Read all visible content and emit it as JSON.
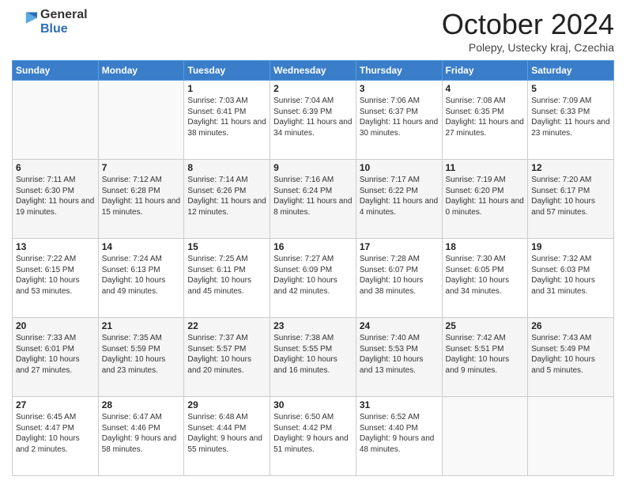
{
  "header": {
    "logo_general": "General",
    "logo_blue": "Blue",
    "month_title": "October 2024",
    "location": "Polepy, Ustecky kraj, Czechia"
  },
  "weekdays": [
    "Sunday",
    "Monday",
    "Tuesday",
    "Wednesday",
    "Thursday",
    "Friday",
    "Saturday"
  ],
  "weeks": [
    [
      {
        "day": "",
        "info": ""
      },
      {
        "day": "",
        "info": ""
      },
      {
        "day": "1",
        "info": "Sunrise: 7:03 AM\nSunset: 6:41 PM\nDaylight: 11 hours and 38 minutes."
      },
      {
        "day": "2",
        "info": "Sunrise: 7:04 AM\nSunset: 6:39 PM\nDaylight: 11 hours and 34 minutes."
      },
      {
        "day": "3",
        "info": "Sunrise: 7:06 AM\nSunset: 6:37 PM\nDaylight: 11 hours and 30 minutes."
      },
      {
        "day": "4",
        "info": "Sunrise: 7:08 AM\nSunset: 6:35 PM\nDaylight: 11 hours and 27 minutes."
      },
      {
        "day": "5",
        "info": "Sunrise: 7:09 AM\nSunset: 6:33 PM\nDaylight: 11 hours and 23 minutes."
      }
    ],
    [
      {
        "day": "6",
        "info": "Sunrise: 7:11 AM\nSunset: 6:30 PM\nDaylight: 11 hours and 19 minutes."
      },
      {
        "day": "7",
        "info": "Sunrise: 7:12 AM\nSunset: 6:28 PM\nDaylight: 11 hours and 15 minutes."
      },
      {
        "day": "8",
        "info": "Sunrise: 7:14 AM\nSunset: 6:26 PM\nDaylight: 11 hours and 12 minutes."
      },
      {
        "day": "9",
        "info": "Sunrise: 7:16 AM\nSunset: 6:24 PM\nDaylight: 11 hours and 8 minutes."
      },
      {
        "day": "10",
        "info": "Sunrise: 7:17 AM\nSunset: 6:22 PM\nDaylight: 11 hours and 4 minutes."
      },
      {
        "day": "11",
        "info": "Sunrise: 7:19 AM\nSunset: 6:20 PM\nDaylight: 11 hours and 0 minutes."
      },
      {
        "day": "12",
        "info": "Sunrise: 7:20 AM\nSunset: 6:17 PM\nDaylight: 10 hours and 57 minutes."
      }
    ],
    [
      {
        "day": "13",
        "info": "Sunrise: 7:22 AM\nSunset: 6:15 PM\nDaylight: 10 hours and 53 minutes."
      },
      {
        "day": "14",
        "info": "Sunrise: 7:24 AM\nSunset: 6:13 PM\nDaylight: 10 hours and 49 minutes."
      },
      {
        "day": "15",
        "info": "Sunrise: 7:25 AM\nSunset: 6:11 PM\nDaylight: 10 hours and 45 minutes."
      },
      {
        "day": "16",
        "info": "Sunrise: 7:27 AM\nSunset: 6:09 PM\nDaylight: 10 hours and 42 minutes."
      },
      {
        "day": "17",
        "info": "Sunrise: 7:28 AM\nSunset: 6:07 PM\nDaylight: 10 hours and 38 minutes."
      },
      {
        "day": "18",
        "info": "Sunrise: 7:30 AM\nSunset: 6:05 PM\nDaylight: 10 hours and 34 minutes."
      },
      {
        "day": "19",
        "info": "Sunrise: 7:32 AM\nSunset: 6:03 PM\nDaylight: 10 hours and 31 minutes."
      }
    ],
    [
      {
        "day": "20",
        "info": "Sunrise: 7:33 AM\nSunset: 6:01 PM\nDaylight: 10 hours and 27 minutes."
      },
      {
        "day": "21",
        "info": "Sunrise: 7:35 AM\nSunset: 5:59 PM\nDaylight: 10 hours and 23 minutes."
      },
      {
        "day": "22",
        "info": "Sunrise: 7:37 AM\nSunset: 5:57 PM\nDaylight: 10 hours and 20 minutes."
      },
      {
        "day": "23",
        "info": "Sunrise: 7:38 AM\nSunset: 5:55 PM\nDaylight: 10 hours and 16 minutes."
      },
      {
        "day": "24",
        "info": "Sunrise: 7:40 AM\nSunset: 5:53 PM\nDaylight: 10 hours and 13 minutes."
      },
      {
        "day": "25",
        "info": "Sunrise: 7:42 AM\nSunset: 5:51 PM\nDaylight: 10 hours and 9 minutes."
      },
      {
        "day": "26",
        "info": "Sunrise: 7:43 AM\nSunset: 5:49 PM\nDaylight: 10 hours and 5 minutes."
      }
    ],
    [
      {
        "day": "27",
        "info": "Sunrise: 6:45 AM\nSunset: 4:47 PM\nDaylight: 10 hours and 2 minutes."
      },
      {
        "day": "28",
        "info": "Sunrise: 6:47 AM\nSunset: 4:46 PM\nDaylight: 9 hours and 58 minutes."
      },
      {
        "day": "29",
        "info": "Sunrise: 6:48 AM\nSunset: 4:44 PM\nDaylight: 9 hours and 55 minutes."
      },
      {
        "day": "30",
        "info": "Sunrise: 6:50 AM\nSunset: 4:42 PM\nDaylight: 9 hours and 51 minutes."
      },
      {
        "day": "31",
        "info": "Sunrise: 6:52 AM\nSunset: 4:40 PM\nDaylight: 9 hours and 48 minutes."
      },
      {
        "day": "",
        "info": ""
      },
      {
        "day": "",
        "info": ""
      }
    ]
  ]
}
